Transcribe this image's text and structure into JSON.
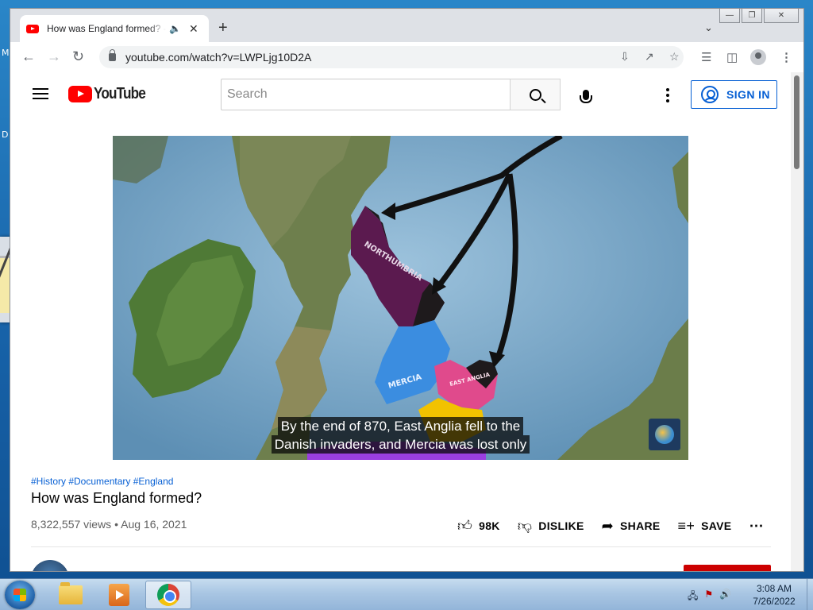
{
  "desktop": {
    "left_letters": [
      "M",
      "D"
    ]
  },
  "browser": {
    "tab_title": "How was England formed? - YouTube",
    "new_tab": "+",
    "url": "youtube.com/watch?v=LWPLjg10D2A"
  },
  "youtube": {
    "logo_text": "YouTube",
    "search_placeholder": "Search",
    "sign_in": "SIGN IN"
  },
  "video": {
    "caption_line1": "By the end of 870, East Anglia fell to the",
    "caption_line2": "Danish invaders, and Mercia was lost only",
    "map_labels": [
      "NORTHUMBRIA",
      "MERCIA",
      "EAST ANGLIA"
    ],
    "hashtags": "#History #Documentary #England",
    "title": "How was England formed?",
    "views": "8,322,557 views",
    "date": "Aug 16, 2021",
    "likes": "98K",
    "dislike": "DISLIKE",
    "share": "SHARE",
    "save": "SAVE"
  },
  "taskbar": {
    "time": "3:08 AM",
    "date": "7/26/2022"
  },
  "colors": {
    "yt_red": "#ff0000",
    "link_blue": "#065fd4",
    "northumbria": "#5b1a4f",
    "mercia": "#3b8de0",
    "east_anglia": "#e04a8c",
    "wessex_yellow": "#f2c200",
    "wessex_purple": "#9b3ee0"
  }
}
